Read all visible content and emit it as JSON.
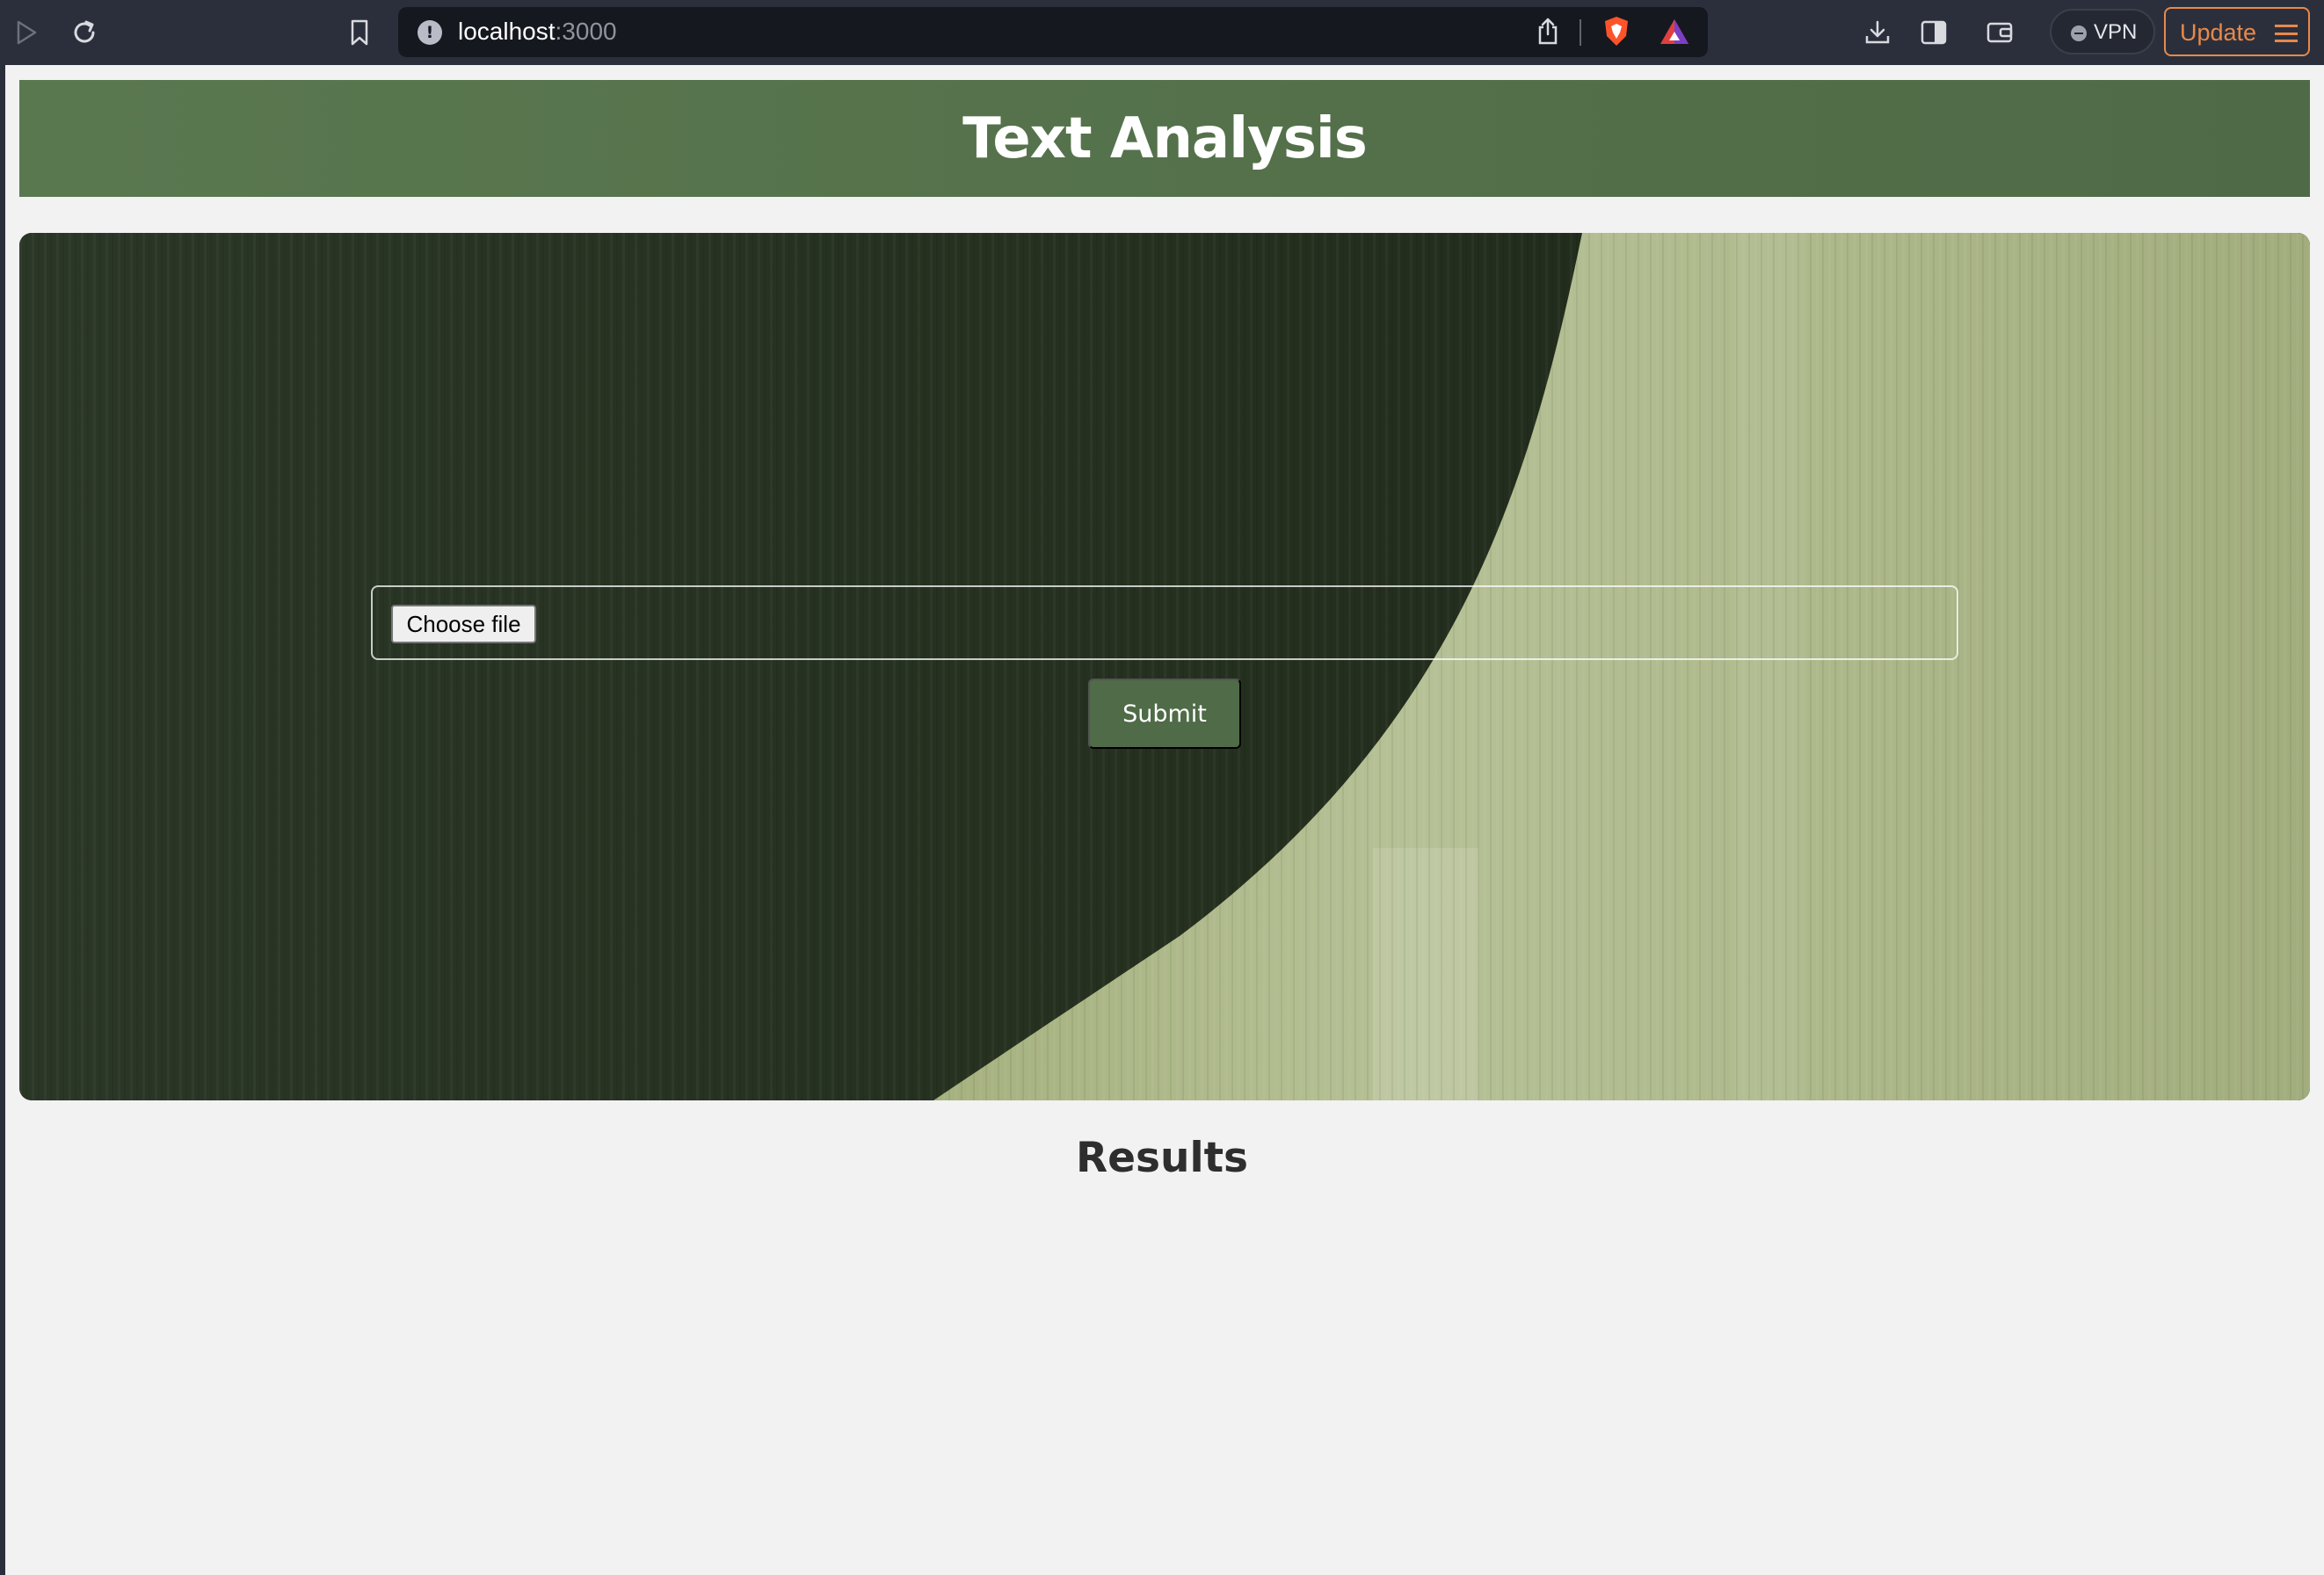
{
  "browser": {
    "url_host": "localhost",
    "url_port": ":3000",
    "vpn_label": "VPN",
    "update_label": "Update",
    "icons": [
      "play-icon",
      "reload-icon",
      "bookmark-icon",
      "site-info-icon",
      "share-icon",
      "brave-shield-icon",
      "brave-rewards-icon",
      "download-icon",
      "sidebar-icon",
      "wallet-icon",
      "menu-icon"
    ]
  },
  "page": {
    "title": "Text Analysis",
    "form": {
      "choose_file_label": "Choose file",
      "submit_label": "Submit"
    },
    "results_heading": "Results"
  },
  "colors": {
    "header_bg": "#557349",
    "accent_button": "#4f6b47",
    "update_orange": "#e8894a"
  }
}
